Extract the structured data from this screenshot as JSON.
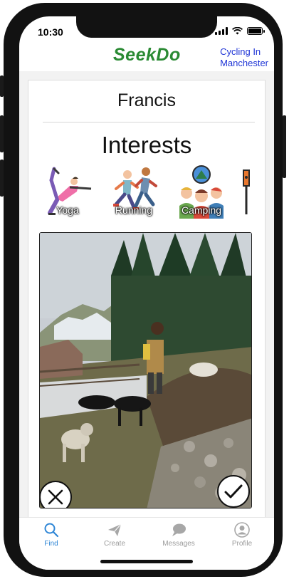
{
  "status_bar": {
    "time": "10:30"
  },
  "header": {
    "logo": "SeekDo",
    "location_line1": "Cycling In",
    "location_line2": "Manchester"
  },
  "profile": {
    "name": "Francis",
    "interests_title": "Interests"
  },
  "interests": [
    {
      "label": "Yoga",
      "icon": "yoga-icon"
    },
    {
      "label": "Running",
      "icon": "running-icon"
    },
    {
      "label": "Camping",
      "icon": "camping-icon"
    },
    {
      "label": "",
      "icon": "partial-icon"
    }
  ],
  "photo": {
    "description_icon": "profile-photo"
  },
  "actions": {
    "reject_icon": "close-icon",
    "accept_icon": "checkmark-icon"
  },
  "tabs": [
    {
      "label": "Find",
      "icon": "search-icon",
      "active": true
    },
    {
      "label": "Create",
      "icon": "paper-plane-icon",
      "active": false
    },
    {
      "label": "Messages",
      "icon": "chat-bubble-icon",
      "active": false
    },
    {
      "label": "Profile",
      "icon": "user-icon",
      "active": false
    }
  ],
  "colors": {
    "logo": "#2a8a33",
    "location": "#1e34d6",
    "tab_active": "#2f86d6",
    "tab_inactive": "#9b9b9b"
  }
}
